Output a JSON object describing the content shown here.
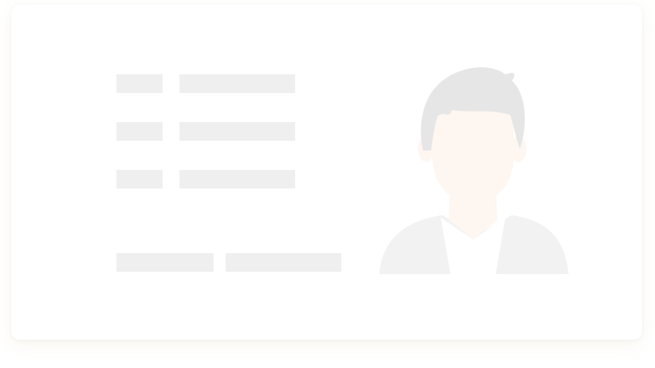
{
  "id_card": {
    "field_rows": 3,
    "footer_fields": 2,
    "placeholder_color": "#efefef",
    "skin_color": "#fdf6f1",
    "hair_color": "#e6e6e6",
    "shirt_color": "#f2f2f2",
    "avatar_icon": "person-avatar-icon"
  }
}
